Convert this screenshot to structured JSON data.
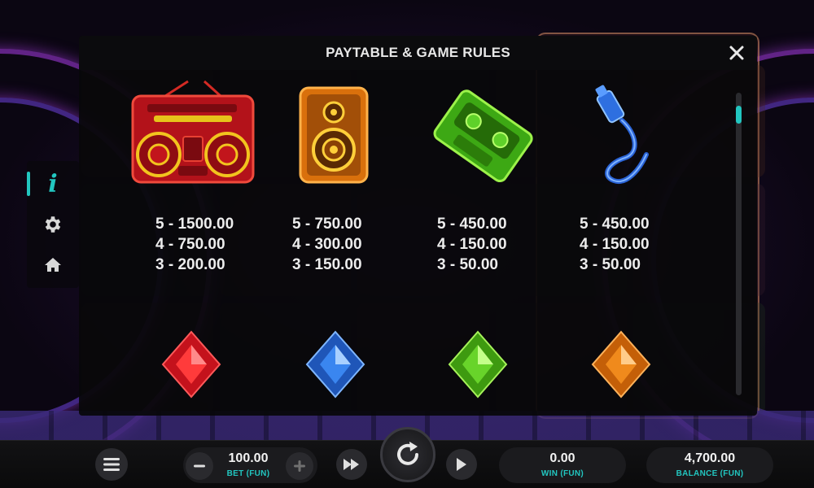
{
  "modal": {
    "title": "PAYTABLE & GAME RULES",
    "close_icon": "close-icon"
  },
  "side_menu": {
    "items": [
      {
        "name": "info",
        "icon": "info-icon",
        "active": true
      },
      {
        "name": "settings",
        "icon": "gear-icon",
        "active": false
      },
      {
        "name": "home",
        "icon": "home-icon",
        "active": false
      }
    ]
  },
  "paytable": {
    "symbols": [
      {
        "icon": "boombox-icon",
        "pays": [
          "5 - 1500.00",
          "4 - 750.00",
          "3 - 200.00"
        ]
      },
      {
        "icon": "speaker-icon",
        "pays": [
          "5 - 750.00",
          "4 - 300.00",
          "3 - 150.00"
        ]
      },
      {
        "icon": "cassette-icon",
        "pays": [
          "5 - 450.00",
          "4 - 150.00",
          "3 - 50.00"
        ]
      },
      {
        "icon": "audio-plug-icon",
        "pays": [
          "5 - 450.00",
          "4 - 150.00",
          "3 - 50.00"
        ]
      }
    ],
    "gems": [
      {
        "icon": "red-gem-icon",
        "color": "#e8222e"
      },
      {
        "icon": "blue-gem-icon",
        "color": "#2f7de0"
      },
      {
        "icon": "green-gem-icon",
        "color": "#5ccc1c"
      },
      {
        "icon": "orange-gem-icon",
        "color": "#f07d12"
      }
    ]
  },
  "bottom_bar": {
    "bet": {
      "value": "100.00",
      "label": "BET (FUN)"
    },
    "win": {
      "value": "0.00",
      "label": "WIN (FUN)"
    },
    "balance": {
      "value": "4,700.00",
      "label": "BALANCE (FUN)"
    }
  },
  "colors": {
    "accent": "#22c6c0"
  }
}
